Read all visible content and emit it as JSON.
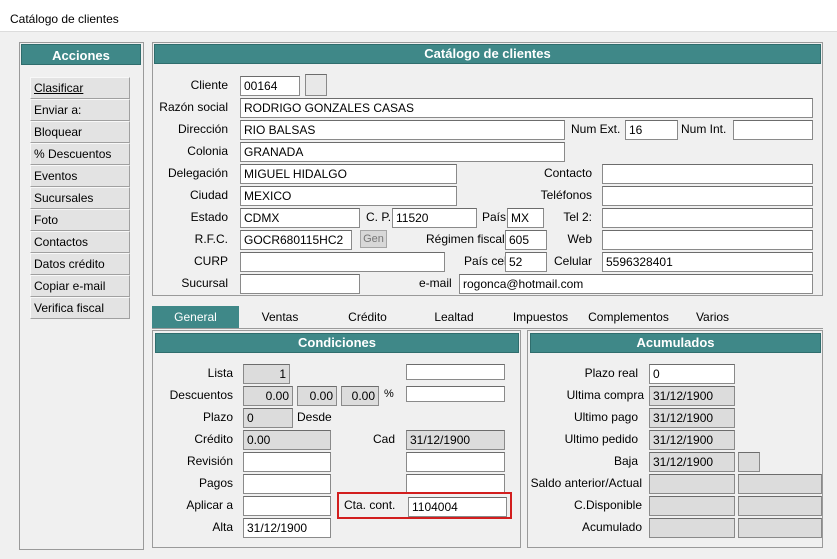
{
  "window": {
    "title": "Catálogo de clientes"
  },
  "sidebar": {
    "title": "Acciones",
    "items": [
      {
        "label": "Clasificar"
      },
      {
        "label": "Enviar a:"
      },
      {
        "label": "Bloquear"
      },
      {
        "label": "% Descuentos"
      },
      {
        "label": "Eventos"
      },
      {
        "label": "Sucursales"
      },
      {
        "label": "Foto"
      },
      {
        "label": "Contactos"
      },
      {
        "label": "Datos crédito"
      },
      {
        "label": "Copiar e-mail"
      },
      {
        "label": "Verifica fiscal"
      }
    ]
  },
  "main": {
    "title": "Catálogo de clientes",
    "labels": {
      "cliente": "Cliente",
      "razon": "Razón social",
      "direccion": "Dirección",
      "numext": "Num Ext.",
      "numint": "Num Int.",
      "colonia": "Colonia",
      "delegacion": "Delegación",
      "contacto": "Contacto",
      "ciudad": "Ciudad",
      "telefonos": "Teléfonos",
      "estado": "Estado",
      "cp": "C. P.",
      "pais": "País",
      "tel2": "Tel 2:",
      "rfc": "R.F.C.",
      "gen": "Gen",
      "regimen": "Régimen fiscal",
      "web": "Web",
      "curp": "CURP",
      "paiscel": "País cel",
      "celular": "Celular",
      "sucursal": "Sucursal",
      "email": "e-mail"
    },
    "values": {
      "cliente": "00164",
      "razon": "RODRIGO GONZALES CASAS",
      "direccion": "RIO BALSAS",
      "numext": "16",
      "numint": "",
      "colonia": "GRANADA",
      "delegacion": "MIGUEL HIDALGO",
      "contacto": "",
      "ciudad": "MEXICO",
      "telefonos": "",
      "estado": "CDMX",
      "cp": "11520",
      "pais": "MX",
      "tel2": "",
      "rfc": "GOCR680115HC2",
      "regimen": "605",
      "web": "",
      "curp": "",
      "paiscel": "52",
      "celular": "5596328401",
      "sucursal": "",
      "email": "rogonca@hotmail.com"
    }
  },
  "tabs": [
    {
      "label": "General"
    },
    {
      "label": "Ventas"
    },
    {
      "label": "Crédito"
    },
    {
      "label": "Lealtad"
    },
    {
      "label": "Impuestos"
    },
    {
      "label": "Complementos"
    },
    {
      "label": "Varios"
    }
  ],
  "condiciones": {
    "title": "Condiciones",
    "labels": {
      "lista": "Lista",
      "descuentos": "Descuentos",
      "pct": "%",
      "plazo": "Plazo",
      "desde": "Desde",
      "credito": "Crédito",
      "cad": "Cad",
      "revision": "Revisión",
      "pagos": "Pagos",
      "aplicar": "Aplicar a",
      "ctacont": "Cta. cont.",
      "alta": "Alta"
    },
    "values": {
      "lista": "1",
      "desc1": "0.00",
      "desc2": "0.00",
      "desc3": "0.00",
      "plazo": "0",
      "credito": "0.00",
      "cad": "31/12/1900",
      "revision": "",
      "pagos": "",
      "aplicar": "",
      "ctacont": "1104004",
      "alta": "31/12/1900"
    }
  },
  "acumulados": {
    "title": "Acumulados",
    "labels": {
      "plazoreal": "Plazo real",
      "ultcompra": "Ultima compra",
      "ultpago": "Ultimo pago",
      "ultpedido": "Ultimo pedido",
      "baja": "Baja",
      "saldoant": "Saldo anterior/Actual",
      "cdisp": "C.Disponible",
      "acum": "Acumulado"
    },
    "values": {
      "plazoreal": "0",
      "ultcompra": "31/12/1900",
      "ultpago": "31/12/1900",
      "ultpedido": "31/12/1900",
      "baja": "31/12/1900"
    }
  },
  "colors": {
    "header": "#3f8888",
    "highlight": "#d21e1e"
  }
}
